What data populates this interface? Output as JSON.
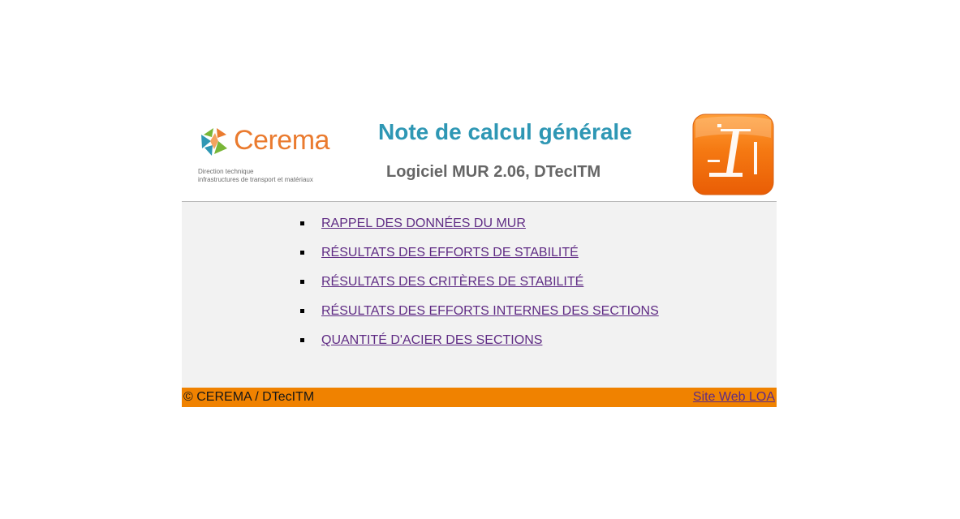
{
  "header": {
    "brand": {
      "name": "Cerema",
      "subtitle_line1": "Direction technique",
      "subtitle_line2": "infrastructures de transport et matériaux",
      "colors": {
        "orange": "#ea7b2f",
        "green": "#79b637",
        "blue": "#2e97b4"
      }
    },
    "title": "Note de calcul générale",
    "subtitle": "Logiciel MUR 2.06, DTecITM",
    "app_icon": "retaining-wall-icon",
    "colors": {
      "title": "#2e97b4",
      "subtitle": "#666666",
      "icon_orange": "#f07a12"
    }
  },
  "menu": {
    "bullet_icon": "square-bullet",
    "items": [
      {
        "label": "RAPPEL DES DONNÉES DU MUR"
      },
      {
        "label": "RÉSULTATS DES EFFORTS DE STABILITÉ"
      },
      {
        "label": "RÉSULTATS DES CRITÈRES DE STABILITÉ"
      },
      {
        "label": "RÉSULTATS DES EFFORTS INTERNES DES SECTIONS"
      },
      {
        "label": "QUANTITÉ D'ACIER DES SECTIONS"
      }
    ],
    "link_color": "#5f2b84",
    "background": "#f2f2f2"
  },
  "footer": {
    "copyright": "© CEREMA / DTecITM",
    "site_link": "Site Web LOA",
    "background": "#f08200"
  }
}
